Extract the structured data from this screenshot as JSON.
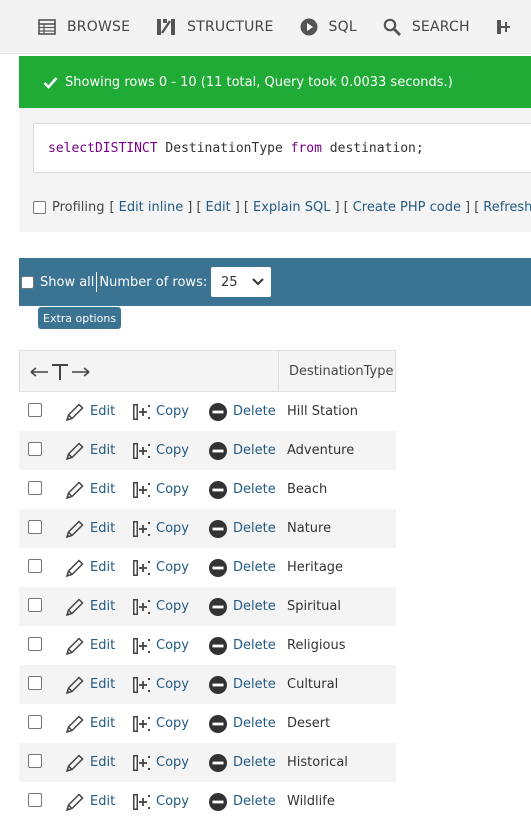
{
  "tabs": [
    {
      "label": "BROWSE",
      "icon": "table-icon"
    },
    {
      "label": "STRUCTURE",
      "icon": "structure-icon"
    },
    {
      "label": "SQL",
      "icon": "play-icon"
    },
    {
      "label": "SEARCH",
      "icon": "search-icon"
    }
  ],
  "success_message": "Showing rows 0 - 10 (11 total, Query took 0.0033 seconds.)",
  "query": {
    "kw1": "select",
    "kw2": "DISTINCT",
    "col": " DestinationType ",
    "kw3": "from",
    "rest": " destination;"
  },
  "profiling": {
    "label": "Profiling",
    "open1": "[",
    "edit_inline": "Edit inline",
    "sep1": "] [",
    "edit": "Edit",
    "sep2": "] [",
    "explain": "Explain SQL",
    "sep3": "] [",
    "php": "Create PHP code",
    "sep4": "] [",
    "refresh": "Refresh",
    "close": "]"
  },
  "nav": {
    "show_all": "Show all",
    "rows_label": "Number of rows:",
    "rows_value": "25"
  },
  "extra_options": "Extra options",
  "table": {
    "column": "DestinationType",
    "actions": {
      "edit": "Edit",
      "copy": "Copy",
      "delete": "Delete"
    },
    "rows": [
      "Hill Station",
      "Adventure",
      "Beach",
      "Nature",
      "Heritage",
      "Spiritual",
      "Religious",
      "Cultural",
      "Desert",
      "Historical",
      "Wildlife"
    ]
  },
  "colors": {
    "success": "#1fab35",
    "navbar": "#3b7493",
    "link": "#235a81",
    "keyword": "#770088"
  }
}
